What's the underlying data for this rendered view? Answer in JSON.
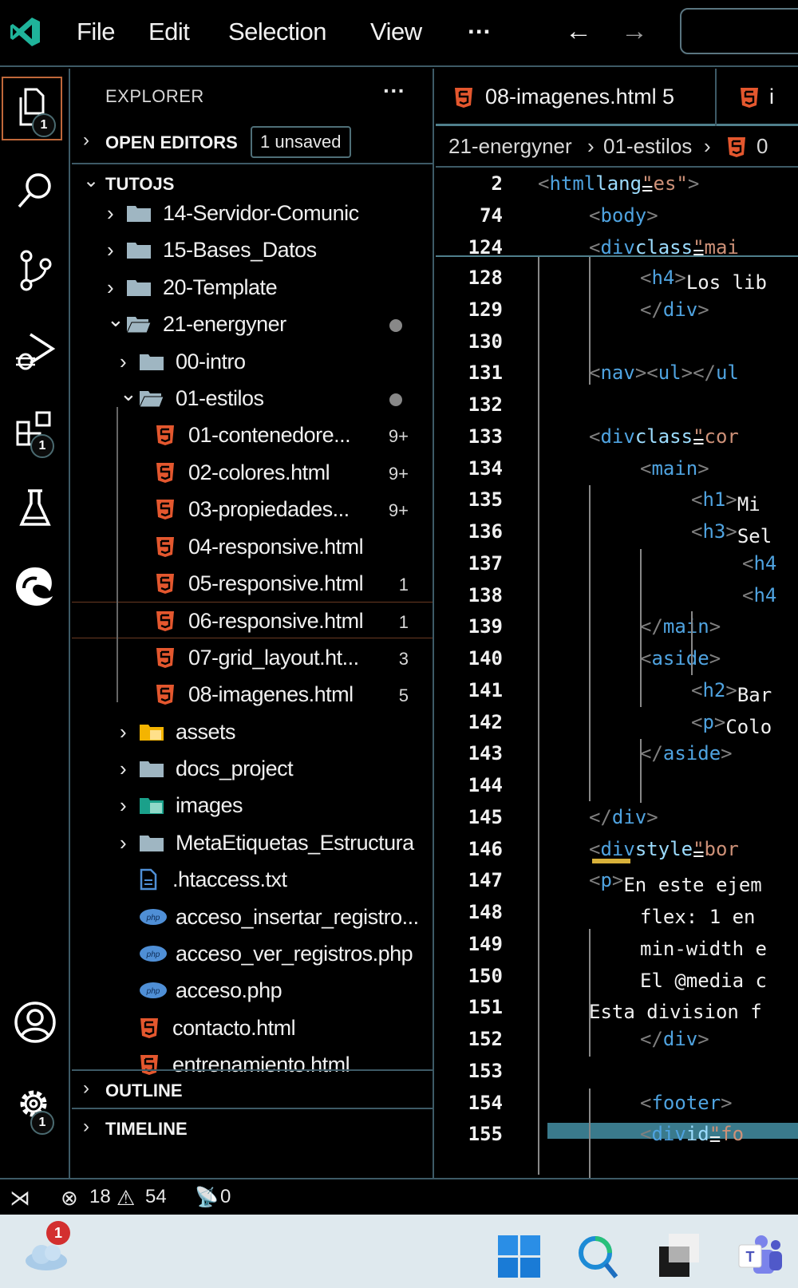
{
  "titlebar": {
    "menu": [
      "File",
      "Edit",
      "Selection",
      "View",
      "···"
    ],
    "back_icon": "arrow-left-icon",
    "forward_icon": "arrow-right-icon"
  },
  "activitybar": {
    "items": [
      {
        "name": "explorer",
        "icon": "files-icon",
        "badge": "1",
        "active": true
      },
      {
        "name": "search",
        "icon": "search-icon"
      },
      {
        "name": "source-control",
        "icon": "source-control-icon"
      },
      {
        "name": "run-debug",
        "icon": "run-debug-icon"
      },
      {
        "name": "extensions",
        "icon": "extensions-icon",
        "badge": "1"
      },
      {
        "name": "testing",
        "icon": "flask-icon"
      },
      {
        "name": "edge-devtools",
        "icon": "edge-icon"
      },
      {
        "name": "accounts",
        "icon": "account-icon"
      },
      {
        "name": "manage",
        "icon": "gear-icon",
        "badge": "1"
      }
    ]
  },
  "sidebar": {
    "title": "EXPLORER",
    "more": "···",
    "open_editors": {
      "label": "OPEN EDITORS",
      "badge": "1 unsaved"
    },
    "workspace": {
      "label": "TUTOJS"
    },
    "tree": [
      {
        "name": "14-Servidor-Comunic",
        "type": "folder",
        "expanded": false,
        "depth": 0
      },
      {
        "name": "15-Bases_Datos",
        "type": "folder",
        "expanded": false,
        "depth": 0
      },
      {
        "name": "20-Template",
        "type": "folder",
        "expanded": false,
        "depth": 0
      },
      {
        "name": "21-energyner",
        "type": "folder",
        "expanded": true,
        "depth": 0,
        "modified_dot": true
      },
      {
        "name": "00-intro",
        "type": "folder",
        "expanded": false,
        "depth": 1
      },
      {
        "name": "01-estilos",
        "type": "folder",
        "expanded": true,
        "depth": 1,
        "modified_dot": true
      },
      {
        "name": "01-contenedore...",
        "type": "html",
        "depth": 2,
        "problems": "9+"
      },
      {
        "name": "02-colores.html",
        "type": "html",
        "depth": 2,
        "problems": "9+"
      },
      {
        "name": "03-propiedades...",
        "type": "html",
        "depth": 2,
        "problems": "9+"
      },
      {
        "name": "04-responsive.html",
        "type": "html",
        "depth": 2,
        "problems": ""
      },
      {
        "name": "05-responsive.html",
        "type": "html",
        "depth": 2,
        "problems": "1"
      },
      {
        "name": "06-responsive.html",
        "type": "html",
        "depth": 2,
        "problems": "1",
        "selected": true
      },
      {
        "name": "07-grid_layout.ht...",
        "type": "html",
        "depth": 2,
        "problems": "3"
      },
      {
        "name": "08-imagenes.html",
        "type": "html",
        "depth": 2,
        "problems": "5"
      },
      {
        "name": "assets",
        "type": "folder-assets",
        "expanded": false,
        "depth": 1
      },
      {
        "name": "docs_project",
        "type": "folder",
        "expanded": false,
        "depth": 1
      },
      {
        "name": "images",
        "type": "folder-images",
        "expanded": false,
        "depth": 1
      },
      {
        "name": "MetaEtiquetas_Estructura",
        "type": "folder",
        "expanded": false,
        "depth": 1
      },
      {
        "name": ".htaccess.txt",
        "type": "txt",
        "depth": 1
      },
      {
        "name": "acceso_insertar_registro...",
        "type": "php",
        "depth": 1
      },
      {
        "name": "acceso_ver_registros.php",
        "type": "php",
        "depth": 1
      },
      {
        "name": "acceso.php",
        "type": "php",
        "depth": 1
      },
      {
        "name": "contacto.html",
        "type": "html",
        "depth": 1
      },
      {
        "name": "entrenamiento.html",
        "type": "html",
        "depth": 1
      }
    ],
    "outline": {
      "label": "OUTLINE"
    },
    "timeline": {
      "label": "TIMELINE"
    }
  },
  "editor": {
    "tabs": [
      {
        "label": "08-imagenes.html",
        "problems": "5",
        "active": true
      },
      {
        "label": "i",
        "active": false
      }
    ],
    "breadcrumb": [
      "21-energyner",
      "01-estilos",
      "0"
    ],
    "sticky_lines": [
      {
        "num": "2",
        "indent": 0,
        "parts": [
          [
            "br",
            "<"
          ],
          [
            "tg",
            "html"
          ],
          [
            "tx",
            " "
          ],
          [
            "at",
            "lang"
          ],
          [
            "tx",
            "="
          ],
          [
            "st",
            "\"es\""
          ],
          [
            "br",
            ">"
          ]
        ]
      },
      {
        "num": "74",
        "indent": 1,
        "parts": [
          [
            "br",
            "<"
          ],
          [
            "tg",
            "body"
          ],
          [
            "br",
            ">"
          ]
        ]
      },
      {
        "num": "124",
        "indent": 1,
        "parts": [
          [
            "br",
            "<"
          ],
          [
            "tg",
            "div"
          ],
          [
            "tx",
            " "
          ],
          [
            "at",
            "class"
          ],
          [
            "tx",
            "="
          ],
          [
            "st",
            "\"mai"
          ]
        ]
      }
    ],
    "lines": [
      {
        "num": "128",
        "indent": 2,
        "parts": [
          [
            "br",
            "<"
          ],
          [
            "tg",
            "h4"
          ],
          [
            "br",
            ">"
          ],
          [
            "tx",
            "Los lib"
          ]
        ]
      },
      {
        "num": "129",
        "indent": 2,
        "parts": [
          [
            "br",
            "</"
          ],
          [
            "tg",
            "div"
          ],
          [
            "br",
            ">"
          ]
        ]
      },
      {
        "num": "130",
        "indent": 2,
        "parts": []
      },
      {
        "num": "131",
        "indent": 1,
        "parts": [
          [
            "br",
            "<"
          ],
          [
            "tg",
            "nav"
          ],
          [
            "tx",
            " "
          ],
          [
            "br",
            ">"
          ],
          [
            "tx",
            " "
          ],
          [
            "br",
            "<"
          ],
          [
            "tg",
            "ul"
          ],
          [
            "br",
            "></"
          ],
          [
            "tg",
            "ul"
          ]
        ]
      },
      {
        "num": "132",
        "indent": 1,
        "parts": []
      },
      {
        "num": "133",
        "indent": 1,
        "parts": [
          [
            "br",
            "<"
          ],
          [
            "tg",
            "div"
          ],
          [
            "tx",
            " "
          ],
          [
            "at",
            "class"
          ],
          [
            "tx",
            "="
          ],
          [
            "st",
            "\"cor"
          ]
        ]
      },
      {
        "num": "134",
        "indent": 2,
        "parts": [
          [
            "br",
            "<"
          ],
          [
            "tg",
            "main"
          ],
          [
            "br",
            ">"
          ]
        ]
      },
      {
        "num": "135",
        "indent": 3,
        "parts": [
          [
            "br",
            "<"
          ],
          [
            "tg",
            "h1"
          ],
          [
            "br",
            ">"
          ],
          [
            "tx",
            "Mi"
          ]
        ]
      },
      {
        "num": "136",
        "indent": 3,
        "parts": [
          [
            "br",
            "<"
          ],
          [
            "tg",
            "h3"
          ],
          [
            "br",
            ">"
          ],
          [
            "tx",
            "Sel"
          ]
        ]
      },
      {
        "num": "137",
        "indent": 4,
        "parts": [
          [
            "br",
            "<"
          ],
          [
            "tg",
            "h4"
          ]
        ]
      },
      {
        "num": "138",
        "indent": 4,
        "parts": [
          [
            "br",
            "<"
          ],
          [
            "tg",
            "h4"
          ]
        ]
      },
      {
        "num": "139",
        "indent": 2,
        "parts": [
          [
            "br",
            "</"
          ],
          [
            "tg",
            "main"
          ],
          [
            "br",
            ">"
          ]
        ]
      },
      {
        "num": "140",
        "indent": 2,
        "parts": [
          [
            "br",
            "<"
          ],
          [
            "tg",
            "aside"
          ],
          [
            "br",
            ">"
          ]
        ]
      },
      {
        "num": "141",
        "indent": 3,
        "parts": [
          [
            "br",
            "<"
          ],
          [
            "tg",
            "h2"
          ],
          [
            "br",
            ">"
          ],
          [
            "tx",
            "Bar"
          ]
        ]
      },
      {
        "num": "142",
        "indent": 3,
        "parts": [
          [
            "br",
            "<"
          ],
          [
            "tg",
            "p"
          ],
          [
            "br",
            ">"
          ],
          [
            "tx",
            "Colo"
          ]
        ]
      },
      {
        "num": "143",
        "indent": 2,
        "parts": [
          [
            "br",
            "</"
          ],
          [
            "tg",
            "aside"
          ],
          [
            "br",
            ">"
          ]
        ]
      },
      {
        "num": "144",
        "indent": 1,
        "parts": []
      },
      {
        "num": "145",
        "indent": 1,
        "parts": [
          [
            "br",
            "</"
          ],
          [
            "tg",
            "div"
          ],
          [
            "br",
            ">"
          ]
        ]
      },
      {
        "num": "146",
        "indent": 1,
        "parts": [
          [
            "br",
            "<"
          ],
          [
            "tg",
            "div"
          ],
          [
            "tx",
            " "
          ],
          [
            "at",
            "style"
          ],
          [
            "tx",
            "="
          ],
          [
            "st",
            "\"bor"
          ]
        ],
        "warning": true
      },
      {
        "num": "147",
        "indent": 1,
        "parts": [
          [
            "br",
            "<"
          ],
          [
            "tg",
            "p"
          ],
          [
            "br",
            ">"
          ],
          [
            "tx",
            "En este ejem"
          ]
        ]
      },
      {
        "num": "148",
        "indent": 2,
        "parts": [
          [
            "tx",
            "flex: 1 en"
          ]
        ]
      },
      {
        "num": "149",
        "indent": 2,
        "parts": [
          [
            "tx",
            "min-width e"
          ]
        ]
      },
      {
        "num": "150",
        "indent": 2,
        "parts": [
          [
            "tx",
            "El @media c"
          ]
        ]
      },
      {
        "num": "151",
        "indent": 1,
        "parts": [
          [
            "tx",
            "Esta division f"
          ]
        ]
      },
      {
        "num": "152",
        "indent": 2,
        "parts": [
          [
            "br",
            "</"
          ],
          [
            "tg",
            "div"
          ],
          [
            "br",
            ">"
          ]
        ]
      },
      {
        "num": "153",
        "indent": 2,
        "parts": []
      },
      {
        "num": "154",
        "indent": 2,
        "parts": [
          [
            "br",
            "<"
          ],
          [
            "tg",
            "footer"
          ],
          [
            "br",
            ">"
          ]
        ]
      },
      {
        "num": "155",
        "indent": 2,
        "parts": [
          [
            "br",
            "<"
          ],
          [
            "tg",
            "div"
          ],
          [
            "tx",
            " "
          ],
          [
            "at",
            "id"
          ],
          [
            "tx",
            "="
          ],
          [
            "st",
            "\"fo"
          ]
        ],
        "cursor": true
      }
    ]
  },
  "statusbar": {
    "remote_icon": "remote-icon",
    "errors": "18",
    "warnings": "54",
    "ports": "0"
  },
  "taskbar": {
    "weather_badge": "1",
    "items": [
      "weather-icon",
      "windows-start-icon",
      "search-icon",
      "task-view-icon",
      "teams-icon"
    ]
  },
  "colors": {
    "accent_border": "#3d5a66",
    "html_icon": "#e4572e",
    "php_icon": "#4f8fd6",
    "active_outline": "#c0683a"
  }
}
